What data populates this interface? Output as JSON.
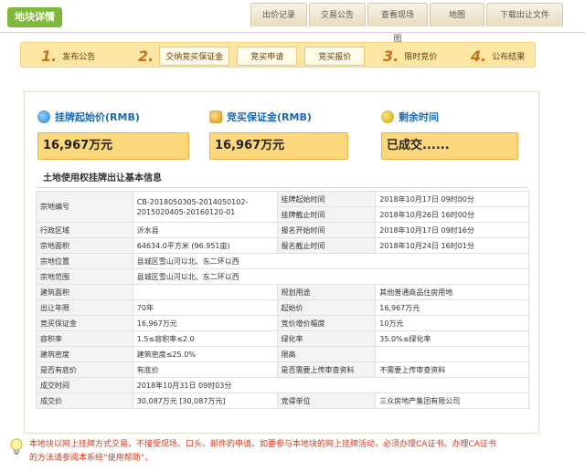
{
  "header": {
    "logo": "地块详情",
    "tabs": [
      "出价记录",
      "交易公告",
      "查看现场图",
      "地图",
      "下载出让文件"
    ]
  },
  "steps": {
    "items": [
      {
        "num": "1.",
        "label": "发布公告"
      },
      {
        "num": "2.",
        "pills": [
          "交纳竞买保证金",
          "竞买申请",
          "竞买报价"
        ]
      },
      {
        "num": "3.",
        "label": "限时竞价"
      },
      {
        "num": "4.",
        "label": "公布结果"
      }
    ]
  },
  "summary": {
    "start_price_title": "挂牌起始价(RMB)",
    "start_price_value": "16,967万元",
    "deposit_title": "竞买保证金(RMB)",
    "deposit_value": "16,967万元",
    "remaining_title": "剩余时间",
    "remaining_value": "已成交......"
  },
  "section_title": "土地使用权挂牌出让基本信息",
  "table": {
    "rows": [
      {
        "k1": "宗地编号",
        "v1": "CB-2018050305-2014050102-2015020405-20160120-01",
        "k2": "挂牌起始时间",
        "v2": "2018年10月17日 09时00分"
      },
      {
        "k2": "挂牌截止时间",
        "v2": "2018年10月26日 16时00分"
      },
      {
        "k1": "行政区域",
        "v1": "沂水县",
        "k2": "报名开始时间",
        "v2": "2018年10月17日 09时16分"
      },
      {
        "k1": "宗地面积",
        "v1": "64634.0平方米 (96.951亩)",
        "k2": "报名截止时间",
        "v2": "2018年10月24日 16时01分"
      },
      {
        "k1": "宗地位置",
        "v1": "县城区雪山河以北、东二环以西"
      },
      {
        "k1": "宗地范围",
        "v1": "县城区雪山河以北、东二环以西"
      },
      {
        "k1": "建筑面积",
        "v1": "",
        "k2": "规划用途",
        "v2": "其他普通商品住房用地"
      },
      {
        "k1": "出让年限",
        "v1": "70年",
        "k2": "起始价",
        "v2": "16,967万元"
      },
      {
        "k1": "竞买保证金",
        "v1": "16,967万元",
        "k2": "竞价增价幅度",
        "v2": "10万元"
      },
      {
        "k1": "容积率",
        "v1": "1.5≤容积率≤2.0",
        "k2": "绿化率",
        "v2": "35.0%≤绿化率"
      },
      {
        "k1": "建筑密度",
        "v1": "建筑密度≤25.0%",
        "k2": "限高",
        "v2": ""
      },
      {
        "k1": "是否有底价",
        "v1": "有底价",
        "k2": "是否需要上传审查资料",
        "v2": "不需要上传审查资料"
      },
      {
        "k1": "成交时间",
        "v1": "2018年10月31日 09时03分"
      },
      {
        "k1": "成交价",
        "v1": "30,087万元 [30,087万元]",
        "k2": "竞得单位",
        "v2": "三众房地产集团有限公司"
      }
    ]
  },
  "notice": {
    "line1": "本地块以网上挂牌方式交易，不接受现场、口头、邮件的申请。如要参与本地块的网上挂牌活动，必须办理CA证书。办理CA证书",
    "line2": "的方法请参阅本系统“使用帮助”。"
  }
}
